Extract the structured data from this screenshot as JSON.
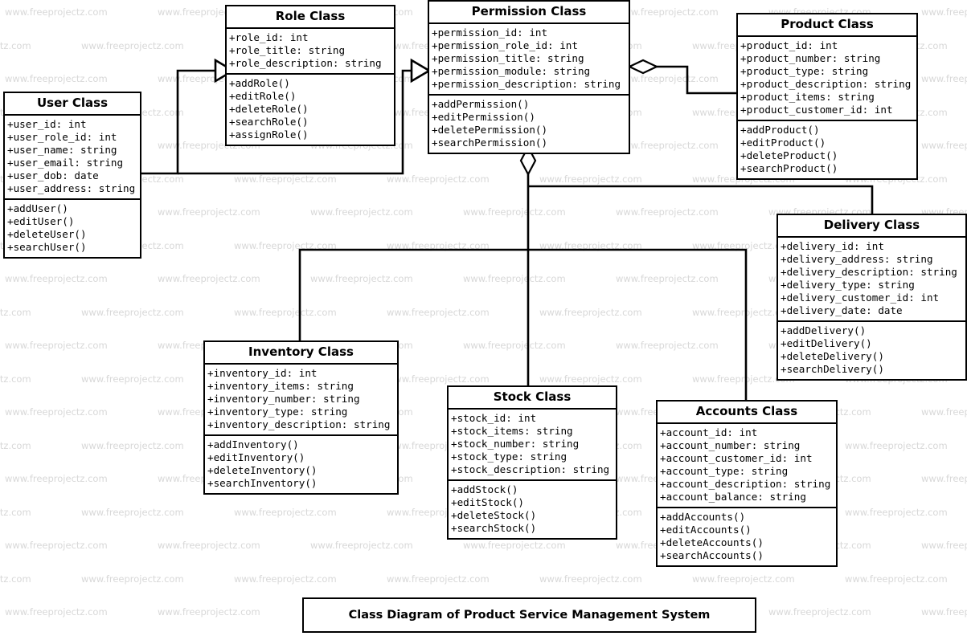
{
  "diagram": {
    "title": "Class Diagram of Product Service Management System",
    "watermark_text": "www.freeprojectz.com",
    "stroke_color": "#000000",
    "background_color": "#ffffff",
    "watermark_color": "#d8d8d8"
  },
  "classes": [
    {
      "id": "user",
      "title": "User Class",
      "attributes": [
        "+user_id: int",
        "+user_role_id: int",
        "+user_name: string",
        "+user_email: string",
        "+user_dob: date",
        "+user_address: string"
      ],
      "methods": [
        "+addUser()",
        "+editUser()",
        "+deleteUser()",
        "+searchUser()"
      ]
    },
    {
      "id": "role",
      "title": "Role Class",
      "attributes": [
        "+role_id: int",
        "+role_title: string",
        "+role_description: string"
      ],
      "methods": [
        "+addRole()",
        "+editRole()",
        "+deleteRole()",
        "+searchRole()",
        "+assignRole()"
      ]
    },
    {
      "id": "permission",
      "title": "Permission Class",
      "attributes": [
        "+permission_id: int",
        "+permission_role_id: int",
        "+permission_title: string",
        "+permission_module: string",
        "+permission_description: string"
      ],
      "methods": [
        "+addPermission()",
        "+editPermission()",
        "+deletePermission()",
        "+searchPermission()"
      ]
    },
    {
      "id": "product",
      "title": "Product Class",
      "attributes": [
        "+product_id: int",
        "+product_number: string",
        "+product_type: string",
        "+product_description: string",
        "+product_items: string",
        "+product_customer_id: int"
      ],
      "methods": [
        "+addProduct()",
        "+editProduct()",
        "+deleteProduct()",
        "+searchProduct()"
      ]
    },
    {
      "id": "delivery",
      "title": "Delivery Class",
      "attributes": [
        "+delivery_id: int",
        "+delivery_address: string",
        "+delivery_description: string",
        "+delivery_type: string",
        "+delivery_customer_id: int",
        "+delivery_date: date"
      ],
      "methods": [
        "+addDelivery()",
        "+editDelivery()",
        "+deleteDelivery()",
        "+searchDelivery()"
      ]
    },
    {
      "id": "inventory",
      "title": "Inventory Class",
      "attributes": [
        "+inventory_id: int",
        "+inventory_items: string",
        "+inventory_number: string",
        "+inventory_type: string",
        "+inventory_description: string"
      ],
      "methods": [
        "+addInventory()",
        "+editInventory()",
        "+deleteInventory()",
        "+searchInventory()"
      ]
    },
    {
      "id": "stock",
      "title": "Stock Class",
      "attributes": [
        "+stock_id: int",
        "+stock_items: string",
        "+stock_number: string",
        "+stock_type: string",
        "+stock_description: string"
      ],
      "methods": [
        "+addStock()",
        "+editStock()",
        "+deleteStock()",
        "+searchStock()"
      ]
    },
    {
      "id": "accounts",
      "title": "Accounts Class",
      "attributes": [
        "+account_id: int",
        "+account_number: string",
        "+account_customer_id: int",
        "+account_type: string",
        "+account_description: string",
        "+account_balance: string"
      ],
      "methods": [
        "+addAccounts()",
        "+editAccounts()",
        "+deleteAccounts()",
        "+searchAccounts()"
      ]
    }
  ],
  "relationships": [
    {
      "from": "user",
      "to": "role",
      "type": "generalization"
    },
    {
      "from": "role",
      "to": "permission",
      "type": "generalization"
    },
    {
      "from": "permission",
      "to": "product",
      "type": "aggregation"
    },
    {
      "from": "permission",
      "to": "stock",
      "type": "aggregation"
    },
    {
      "from": "permission",
      "to": "inventory",
      "type": "association"
    },
    {
      "from": "permission",
      "to": "delivery",
      "type": "association"
    },
    {
      "from": "permission",
      "to": "accounts",
      "type": "association"
    }
  ]
}
